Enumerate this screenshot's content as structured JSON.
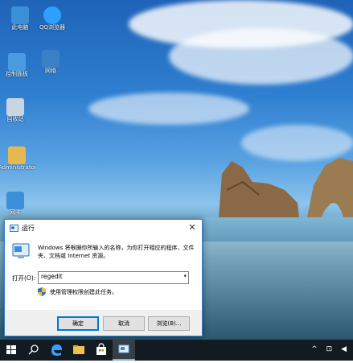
{
  "desktop": {
    "icons": [
      {
        "label": "此电脑",
        "icon": "this-pc-icon",
        "color": "#3a8fd6"
      },
      {
        "label": "QQ浏览器",
        "icon": "qq-browser-icon",
        "color": "#2ea0ff"
      },
      {
        "label": "控制面板",
        "icon": "control-panel-icon",
        "color": "#4a9be0"
      },
      {
        "label": "网络",
        "icon": "network-icon",
        "color": "#3b7fc4"
      },
      {
        "label": "回收站",
        "icon": "recycle-bin-icon",
        "color": "#c9d6e2"
      },
      {
        "label": "Administrator",
        "icon": "user-folder-icon",
        "color": "#e7b84e"
      },
      {
        "label": "网卡",
        "icon": "network-adapter-icon",
        "color": "#3a8fd6"
      }
    ]
  },
  "run_dialog": {
    "title": "运行",
    "description": "Windows 将根据你所输入的名称，为你打开相应的程序、文件夹、文档或 Internet 资源。",
    "open_label": "打开(O):",
    "input_value": "regedit",
    "admin_note": "使用管理权限创建此任务。",
    "ok_label": "确定",
    "cancel_label": "取消",
    "browse_label": "浏览(B)...",
    "close_glyph": "✕"
  },
  "taskbar": {
    "items": [
      "windows-start-icon",
      "search-icon",
      "edge-icon",
      "file-explorer-icon",
      "store-icon",
      "run-app-icon"
    ],
    "tray": "^ ⊡ ◀"
  }
}
